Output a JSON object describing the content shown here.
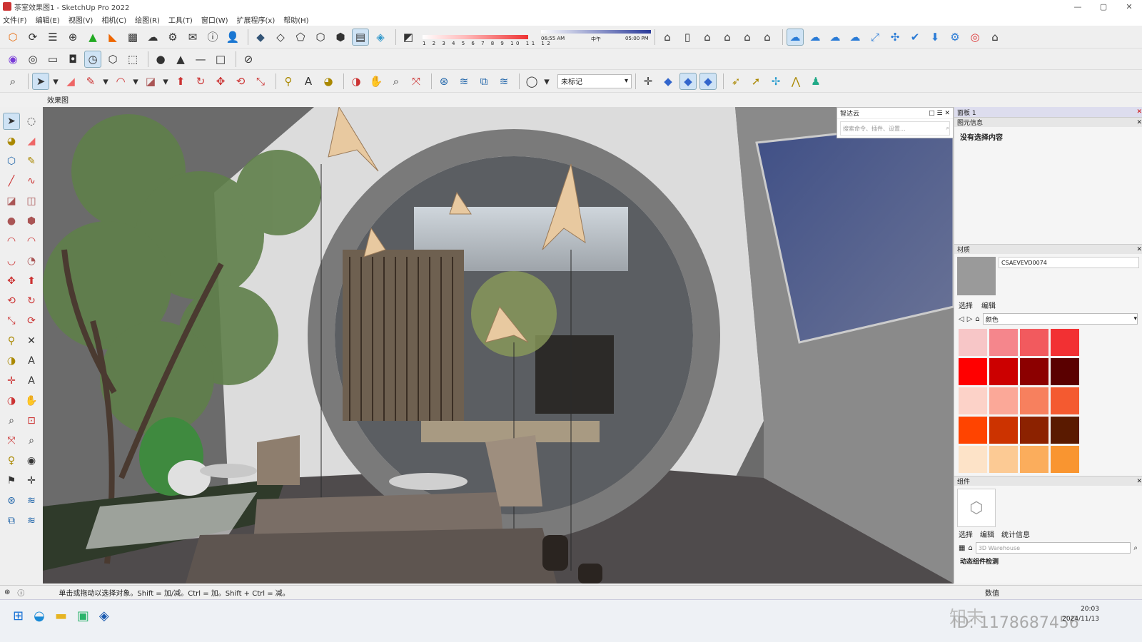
{
  "window": {
    "title": "茶室效果图1 - SketchUp Pro 2022",
    "min": "—",
    "max": "▢",
    "close": "✕"
  },
  "menu": [
    "文件(F)",
    "编辑(E)",
    "视图(V)",
    "相机(C)",
    "绘图(R)",
    "工具(T)",
    "窗口(W)",
    "扩展程序(x)",
    "帮助(H)"
  ],
  "shadow": {
    "months": "1 2 3 4 5 6 7 8 9 10 11 12",
    "time_start": "06:55 AM",
    "time_mid": "中午",
    "time_end": "05:00 PM"
  },
  "tag_select": {
    "value": "未标记"
  },
  "scene_tab": "效果图",
  "zhidayun": {
    "title": "智达云",
    "placeholder": "搜索命令、插件、设置..."
  },
  "panel": {
    "title": "面板 1",
    "entity_info_title": "图元信息",
    "entity_info_text": "没有选择内容",
    "materials_title": "材质",
    "material_name": "CSAEVEVD0074",
    "tab_select": "选择",
    "tab_edit": "编辑",
    "collection": "颜色",
    "swatches": [
      "#f7c6c7",
      "#f5868c",
      "#f25a5e",
      "#f23033",
      "#ff0000",
      "#cc0000",
      "#8c0000",
      "#5a0000",
      "#fcd2c8",
      "#fba898",
      "#f7805e",
      "#f45a30",
      "#ff4400",
      "#cc3300",
      "#8c2200",
      "#5a1a00",
      "#fde3c8",
      "#fcca94",
      "#fbad5c",
      "#f99530"
    ],
    "components_title": "组件",
    "comp_tab_select": "选择",
    "comp_tab_edit": "编辑",
    "comp_tab_stats": "统计信息",
    "comp_search": "3D Warehouse",
    "comp_dyn": "动态组件检测",
    "tray_data": "数值"
  },
  "status": {
    "text": "单击或拖动以选择对象。Shift = 加/减。Ctrl = 加。Shift + Ctrl = 减。"
  },
  "taskbar": {
    "time": "20:03",
    "date": "2024/11/13"
  },
  "watermark": {
    "brand": "知末",
    "id": "ID: 1178687456"
  }
}
